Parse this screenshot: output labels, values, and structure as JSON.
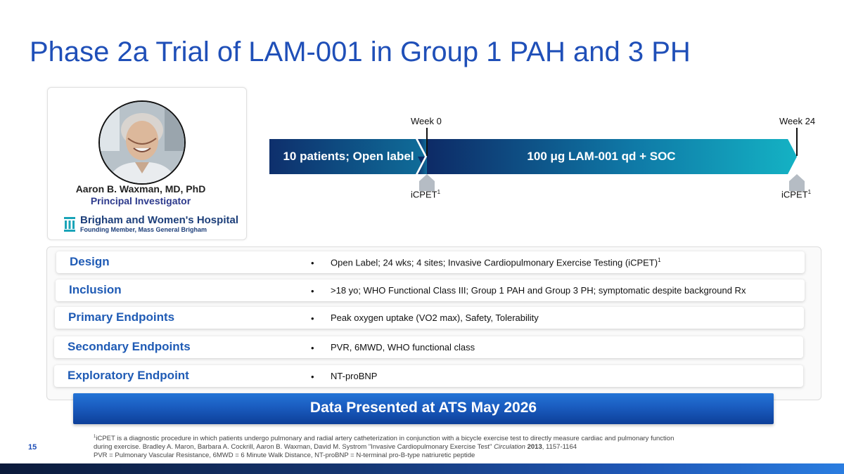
{
  "title": "Phase 2a Trial of LAM-001 in Group 1 PAH and 3 PH",
  "investigator": {
    "name": "Aaron B. Waxman, MD, PhD",
    "role": "Principal Investigator",
    "hospital_name": "Brigham and Women's Hospital",
    "hospital_sub": "Founding Member, Mass General Brigham"
  },
  "timeline": {
    "week_start": "Week 0",
    "week_end": "Week 24",
    "segment1": "10 patients; Open label",
    "segment2_prefix": "100 ",
    "segment2_unit": "μg",
    "segment2_suffix": " LAM-001 qd + SOC",
    "icpet_label": "iCPET",
    "icpet_sup": "1"
  },
  "rows": [
    {
      "label": "Design",
      "bullet": "•",
      "text": "Open Label; 24 wks; 4 sites; Invasive Cardiopulmonary Exercise Testing (iCPET)",
      "sup": "1"
    },
    {
      "label": "Inclusion",
      "bullet": "•",
      "text": ">18 yo; WHO Functional Class III; Group 1 PAH and Group 3 PH; symptomatic despite background Rx",
      "sup": ""
    },
    {
      "label": "Primary Endpoints",
      "bullet": "•",
      "text": "Peak oxygen uptake (VO2 max), Safety, Tolerability",
      "sup": ""
    },
    {
      "label": "Secondary Endpoints",
      "bullet": "•",
      "text": "PVR, 6MWD, WHO functional class",
      "sup": ""
    },
    {
      "label": "Exploratory Endpoint",
      "bullet": "•",
      "text": "NT-proBNP",
      "sup": ""
    }
  ],
  "banner": "Data Presented at ATS May 2026",
  "page_number": "15",
  "footnotes": {
    "line1_sup": "1",
    "line1": "iCPET is a diagnostic procedure in which patients undergo pulmonary and radial artery catheterization in conjunction with a bicycle exercise test to directly measure cardiac and pulmonary function",
    "line2_a": "during exercise.  Bradley A. Maron, Barbara A. Cockrill, Aaron B. Waxman, David M. Systrom \"Invasive Cardiopulmonary Exercise Test\" ",
    "line2_italic": "Circulation",
    "line2_space": " ",
    "line2_bold": "2013",
    "line2_b": ", 1157-1164",
    "line3": "PVR = Pulmonary Vascular Resistance, 6MWD = 6 Minute Walk Distance, NT-proBNP = N-terminal pro-B-type natriuretic peptide"
  },
  "colors": {
    "title": "#1f4fb8",
    "row_label": "#1f5bb5",
    "arrow_dark": "#0d2f6e",
    "arrow_teal": "#13a9bf"
  }
}
